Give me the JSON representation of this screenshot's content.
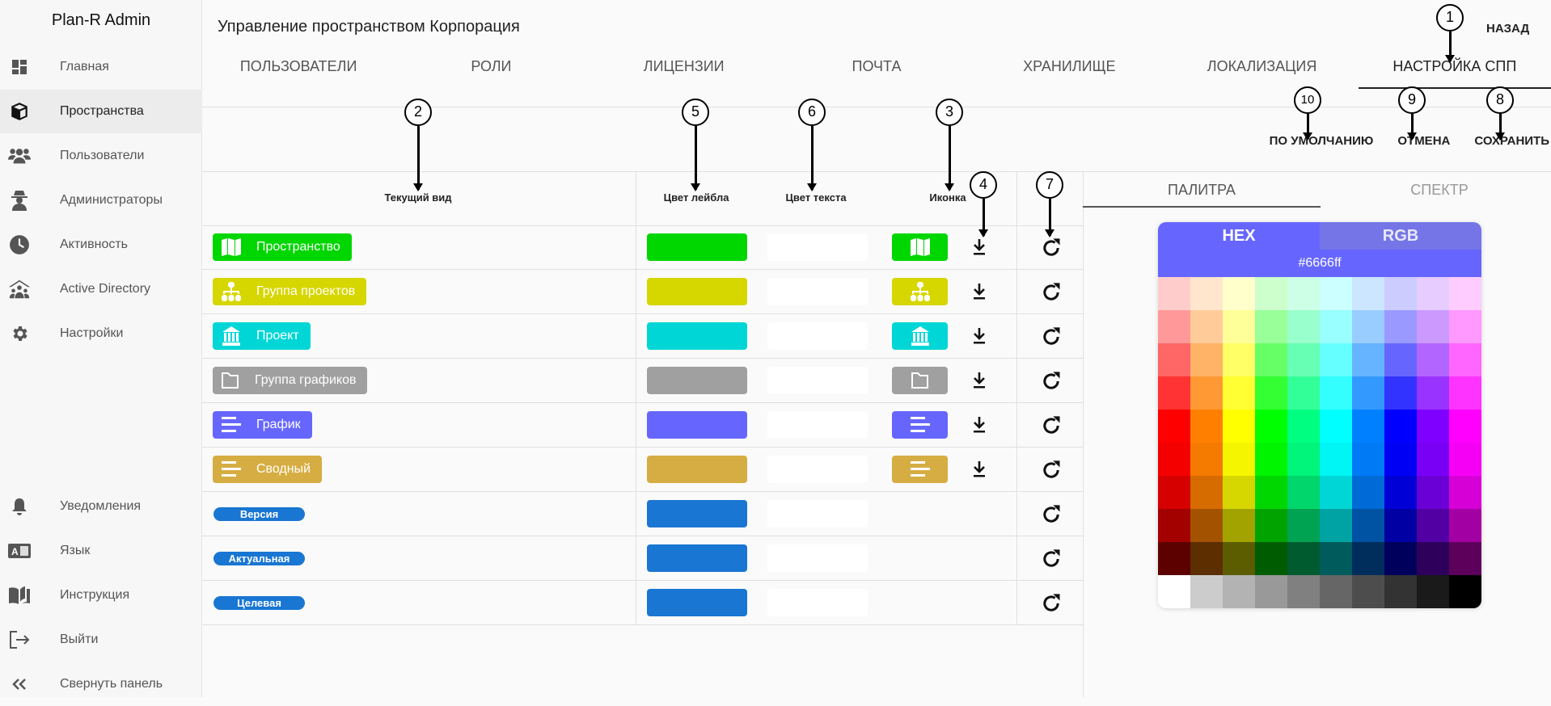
{
  "sidebar": {
    "brand": "Plan-R Admin",
    "items": [
      {
        "label": "Главная",
        "icon": "dashboard-icon"
      },
      {
        "label": "Пространства",
        "icon": "cube-icon",
        "active": true
      },
      {
        "label": "Пользователи",
        "icon": "users-icon"
      },
      {
        "label": "Администраторы",
        "icon": "spy-icon"
      },
      {
        "label": "Активность",
        "icon": "clock-icon"
      },
      {
        "label": "Active Directory",
        "icon": "network-users-icon"
      },
      {
        "label": "Настройки",
        "icon": "gear-icon"
      }
    ],
    "bottom": [
      {
        "label": "Уведомления",
        "icon": "bell-icon"
      },
      {
        "label": "Язык",
        "icon": "translate-icon"
      },
      {
        "label": "Инструкция",
        "icon": "book-icon"
      },
      {
        "label": "Выйти",
        "icon": "logout-icon"
      },
      {
        "label": "Свернуть панель",
        "icon": "double-chevron-left-icon"
      }
    ]
  },
  "header": {
    "title": "Управление пространством Корпорация",
    "back": "НАЗАД"
  },
  "tabs": [
    "ПОЛЬЗОВАТЕЛИ",
    "РОЛИ",
    "ЛИЦЕНЗИИ",
    "ПОЧТА",
    "ХРАНИЛИЩЕ",
    "ЛОКАЛИЗАЦИЯ",
    "НАСТРОЙКА СПП"
  ],
  "active_tab": "НАСТРОЙКА СПП",
  "actions": {
    "default": "ПО УМОЛЧАНИЮ",
    "cancel": "ОТМЕНА",
    "save": "СОХРАНИТЬ"
  },
  "table": {
    "headers": {
      "current": "Текущий вид",
      "label_color": "Цвет лейбла",
      "text_color": "Цвет текста",
      "icon": "Иконка"
    },
    "rows": [
      {
        "label": "Пространство",
        "color": "#00d600",
        "text_color": "#ffffff",
        "icon": "map-icon"
      },
      {
        "label": "Группа проектов",
        "color": "#d6d600",
        "text_color": "#ffffff",
        "icon": "sitemap-icon"
      },
      {
        "label": "Проект",
        "color": "#00d6d6",
        "text_color": "#ffffff",
        "icon": "bank-icon"
      },
      {
        "label": "Группа графиков",
        "color": "#a0a0a0",
        "text_color": "#ffffff",
        "icon": "folder-icon"
      },
      {
        "label": "График",
        "color": "#6666ff",
        "text_color": "#ffffff",
        "icon": "list-icon"
      },
      {
        "label": "Сводный",
        "color": "#d6ad42",
        "text_color": "#ffffff",
        "icon": "list-icon"
      },
      {
        "label": "Версия",
        "color": "#1976d2",
        "text_color": "#ffffff",
        "icon": null
      },
      {
        "label": "Актуальная",
        "color": "#1976d2",
        "text_color": "#ffffff",
        "icon": null
      },
      {
        "label": "Целевая",
        "color": "#1976d2",
        "text_color": "#ffffff",
        "icon": null
      }
    ]
  },
  "picker": {
    "tabs": [
      "ПАЛИТРА",
      "СПЕКТР"
    ],
    "active_tab": "ПАЛИТРА",
    "modes": [
      "HEX",
      "RGB"
    ],
    "active_mode": "HEX",
    "value": "#6666ff",
    "palette": [
      [
        "#ffcccc",
        "#ffe6cc",
        "#ffffcc",
        "#ccffcc",
        "#ccffe6",
        "#ccffff",
        "#cce6ff",
        "#ccccff",
        "#e6ccff",
        "#ffccff"
      ],
      [
        "#ff9999",
        "#ffcc99",
        "#ffff99",
        "#99ff99",
        "#99ffcc",
        "#99ffff",
        "#99ccff",
        "#9999ff",
        "#cc99ff",
        "#ff99ff"
      ],
      [
        "#ff6666",
        "#ffb366",
        "#ffff66",
        "#66ff66",
        "#66ffb3",
        "#66ffff",
        "#66b3ff",
        "#6666ff",
        "#b366ff",
        "#ff66ff"
      ],
      [
        "#ff3333",
        "#ff9933",
        "#ffff33",
        "#33ff33",
        "#33ff99",
        "#33ffff",
        "#3399ff",
        "#3333ff",
        "#9933ff",
        "#ff33ff"
      ],
      [
        "#ff0000",
        "#ff8000",
        "#ffff00",
        "#00ff00",
        "#00ff80",
        "#00ffff",
        "#0080ff",
        "#0000ff",
        "#8000ff",
        "#ff00ff"
      ],
      [
        "#f50000",
        "#f57a00",
        "#f5f500",
        "#00f500",
        "#00f57a",
        "#00f5f5",
        "#007af5",
        "#0000f5",
        "#7a00f5",
        "#f500f5"
      ],
      [
        "#d60000",
        "#d66b00",
        "#d6d600",
        "#00d600",
        "#00d66b",
        "#00d6d6",
        "#006bd6",
        "#0000d6",
        "#6b00d6",
        "#d600d6"
      ],
      [
        "#a30000",
        "#a35200",
        "#a3a300",
        "#00a300",
        "#00a352",
        "#00a3a3",
        "#0052a3",
        "#0000a3",
        "#5200a3",
        "#a300a3"
      ],
      [
        "#5c0000",
        "#5c2e00",
        "#5c5c00",
        "#005c00",
        "#005c2e",
        "#005c5c",
        "#002e5c",
        "#00005c",
        "#2e005c",
        "#5c005c"
      ],
      [
        "#ffffff",
        "#cccccc",
        "#b3b3b3",
        "#999999",
        "#808080",
        "#666666",
        "#4d4d4d",
        "#333333",
        "#1a1a1a",
        "#000000"
      ]
    ]
  },
  "annotations": [
    "1",
    "2",
    "3",
    "4",
    "5",
    "6",
    "7",
    "8",
    "9",
    "10"
  ]
}
